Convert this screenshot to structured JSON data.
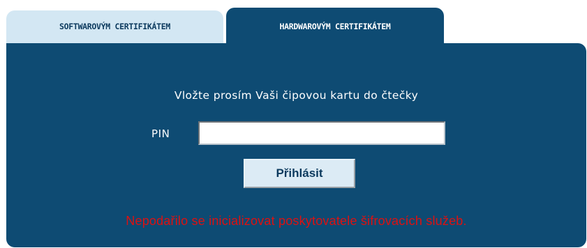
{
  "tabs": [
    {
      "label": "SOFTWAROVÝM CERTIFIKÁTEM",
      "active": false
    },
    {
      "label": "HARDWAROVÝM CERTIFIKÁTEM",
      "active": true
    }
  ],
  "panel": {
    "prompt": "Vložte prosím Vaši čipovou kartu do čtečky",
    "pin_label": "PIN",
    "pin_value": "",
    "login_button_label": "Přihlásit",
    "error_message": "Nepodařilo se inicializovat poskytovatele šifrovacích služeb."
  },
  "colors": {
    "panel_background": "#0e4b73",
    "inactive_tab_background": "#d3e7f3",
    "error_text": "#dd1111",
    "button_background": "#dcebf5"
  }
}
